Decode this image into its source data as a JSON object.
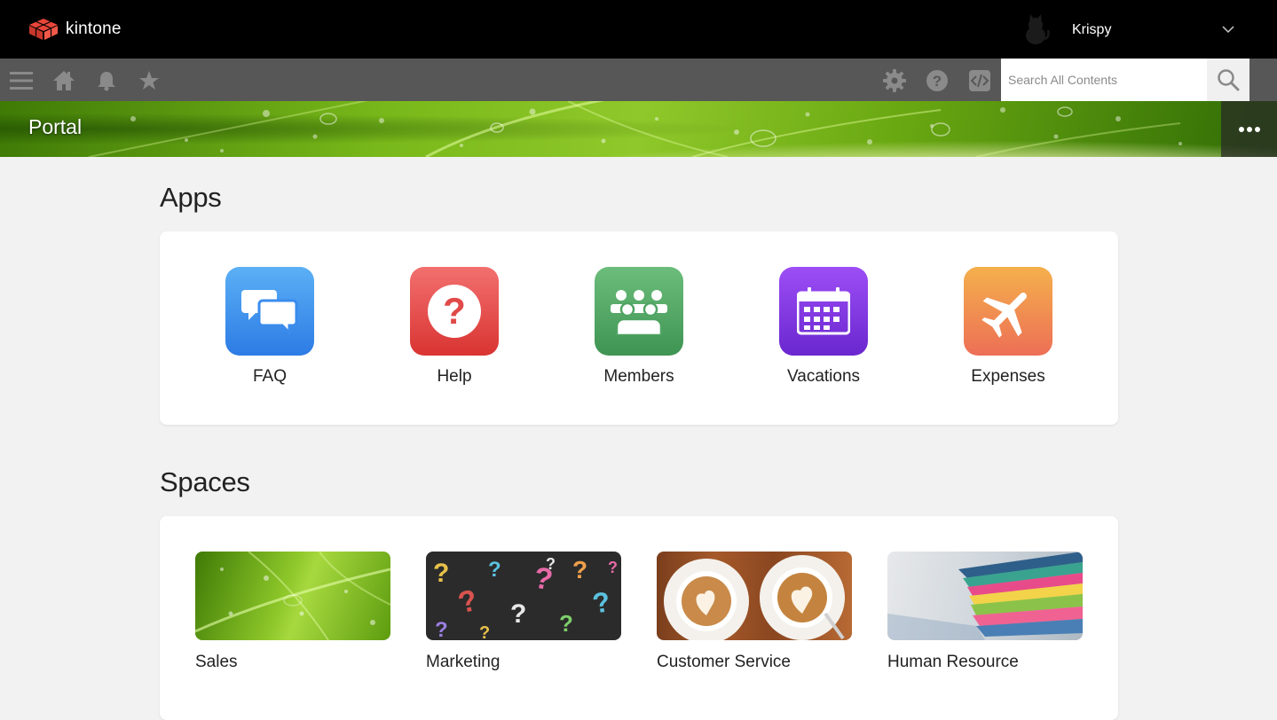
{
  "header": {
    "brand": "kintone",
    "brand_color": "#e8463a",
    "user": {
      "name": "Krispy"
    }
  },
  "toolbar": {
    "search_placeholder": "Search All Contents",
    "icons": [
      "menu-icon",
      "home-icon",
      "bell-icon",
      "star-icon",
      "gear-icon",
      "help-icon",
      "code-icon",
      "search-icon"
    ]
  },
  "banner": {
    "title": "Portal"
  },
  "apps": {
    "heading": "Apps",
    "items": [
      {
        "label": "FAQ",
        "icon": "chat-bubbles-icon",
        "color_top": "#5bb0f5",
        "color_bottom": "#2d7be5"
      },
      {
        "label": "Help",
        "icon": "question-icon",
        "color_top": "#f2706f",
        "color_bottom": "#d93431"
      },
      {
        "label": "Members",
        "icon": "group-icon",
        "color_top": "#6cbd7b",
        "color_bottom": "#3f9453"
      },
      {
        "label": "Vacations",
        "icon": "calendar-icon",
        "color_top": "#9d4ef5",
        "color_bottom": "#6a27cf"
      },
      {
        "label": "Expenses",
        "icon": "airplane-icon",
        "color_top": "#f4b04c",
        "color_bottom": "#ed6f56"
      }
    ]
  },
  "spaces": {
    "heading": "Spaces",
    "items": [
      {
        "label": "Sales",
        "image": "green-leaf"
      },
      {
        "label": "Marketing",
        "image": "question-marks-chalkboard"
      },
      {
        "label": "Customer Service",
        "image": "latte-coffee-cups"
      },
      {
        "label": "Human Resource",
        "image": "colorful-folders"
      }
    ]
  }
}
